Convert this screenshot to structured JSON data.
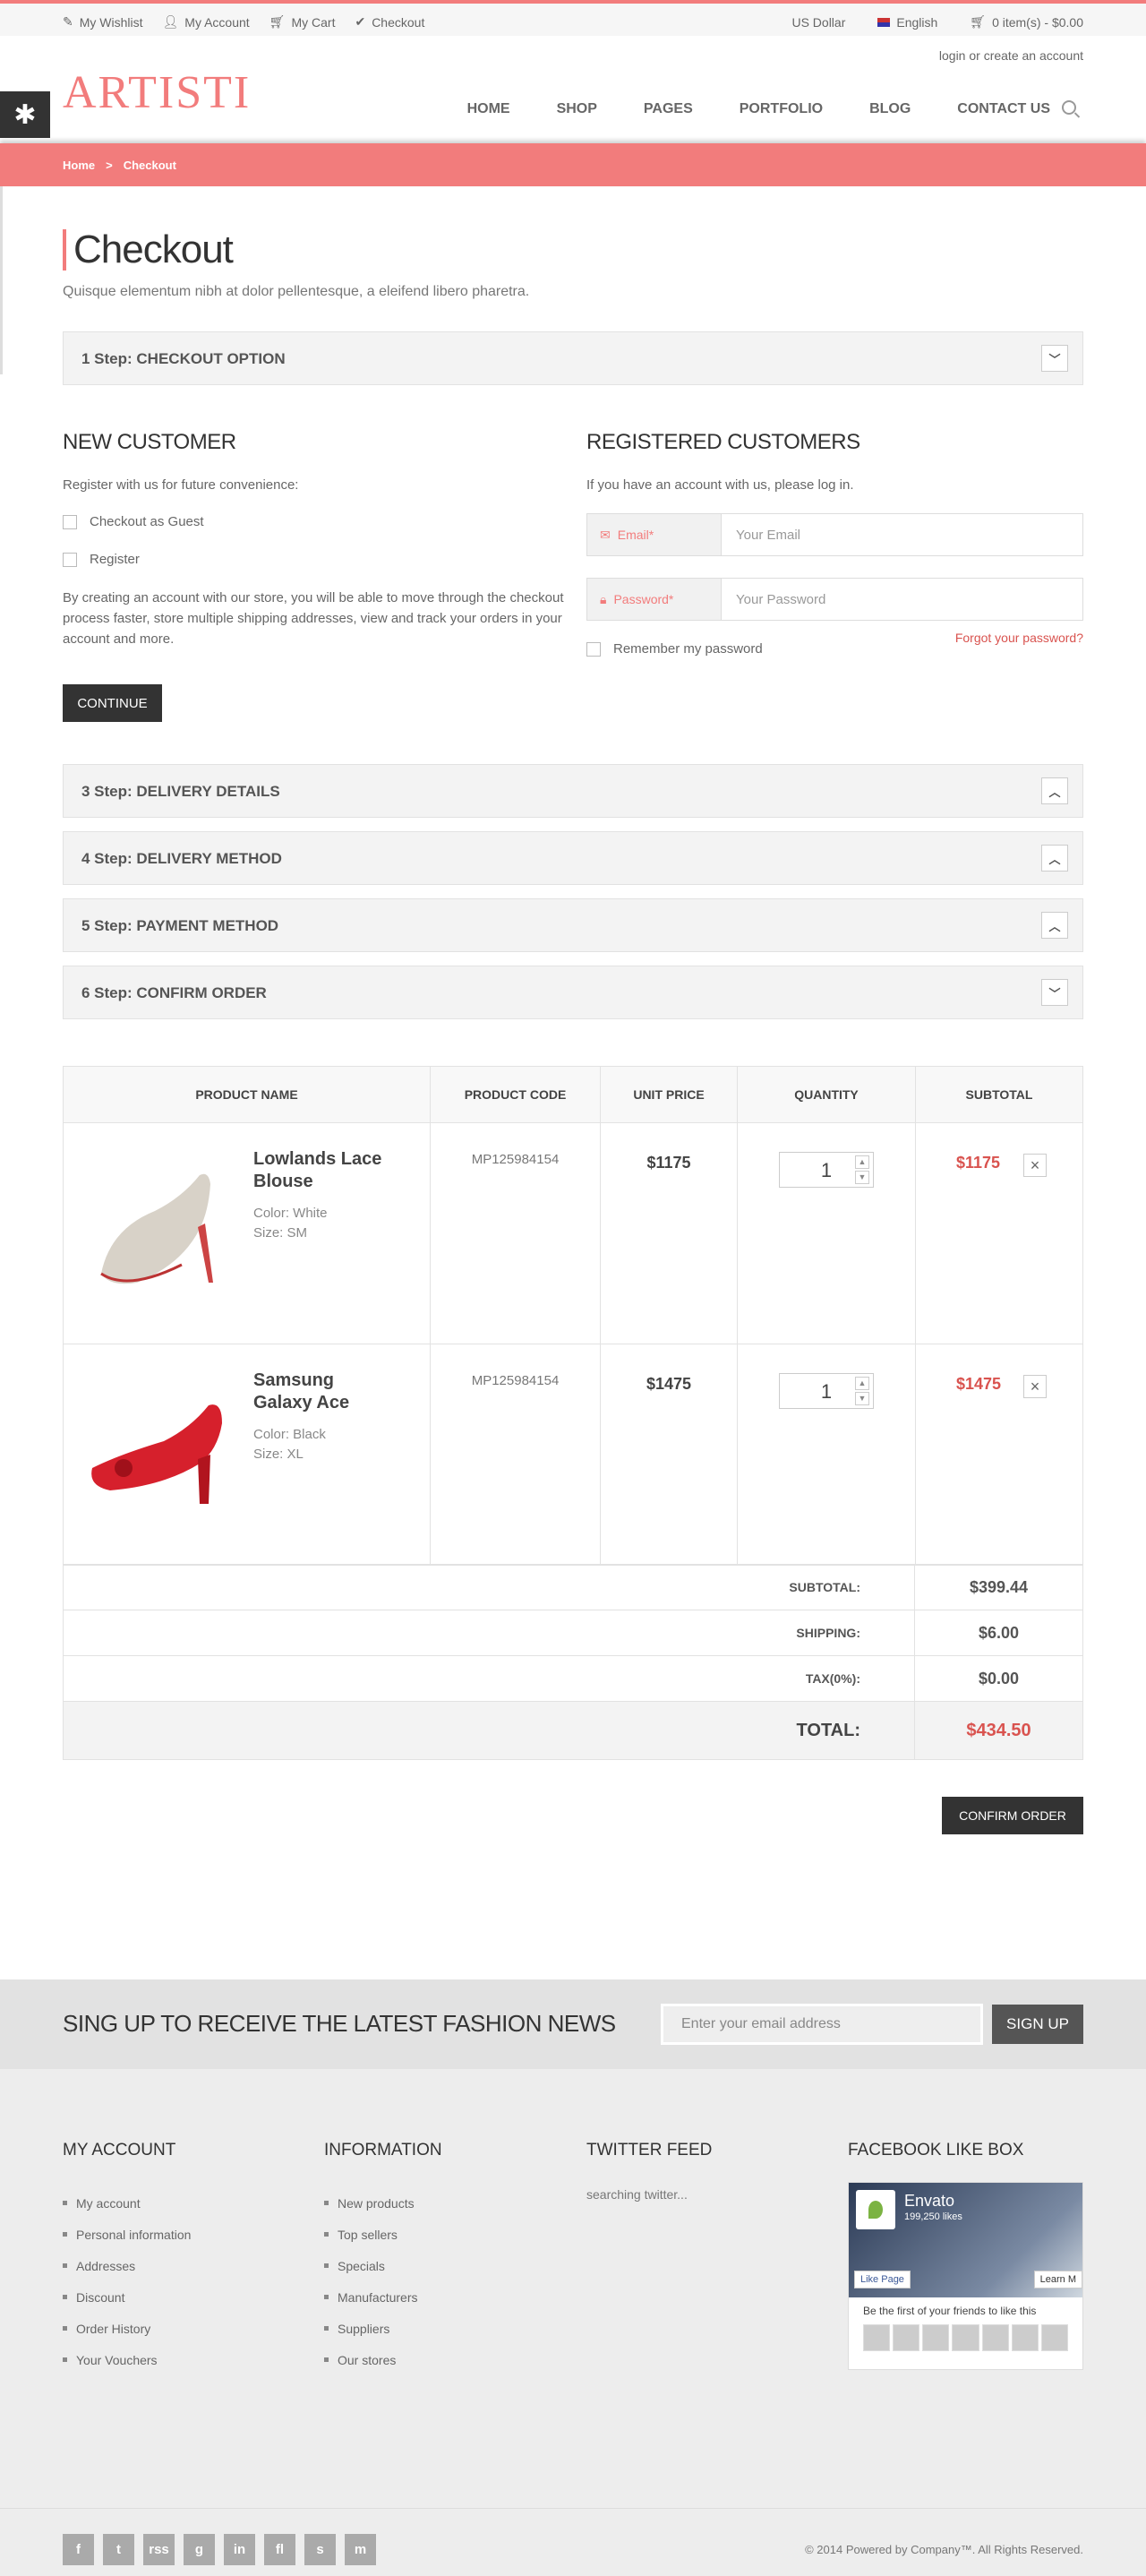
{
  "topbar": {
    "wishlist": "My Wishlist",
    "account": "My Account",
    "cart": "My Cart",
    "checkout": "Checkout",
    "currency": "US Dollar",
    "language": "English",
    "cart_summary": "0 item(s) - $0.00"
  },
  "login": "login or create an account",
  "logo": "ARTISTI",
  "nav": [
    "HOME",
    "SHOP",
    "PAGES",
    "PORTFOLIO",
    "BLOG",
    "CONTACT US"
  ],
  "breadcrumb": {
    "home": "Home",
    "sep": ">",
    "current": "Checkout"
  },
  "page": {
    "title": "Checkout",
    "subtitle": "Quisque elementum nibh at dolor pellentesque, a eleifend libero pharetra."
  },
  "steps": {
    "s1": "1 Step:  CHECKOUT OPTION",
    "s3": "3 Step:  DELIVERY DETAILS",
    "s4": "4 Step:  DELIVERY METHOD",
    "s5": "5 Step:  PAYMENT METHOD",
    "s6": "6 Step:  CONFIRM ORDER"
  },
  "new_customer": {
    "title": "NEW CUSTOMER",
    "intro": "Register with us for future convenience:",
    "guest": "Checkout as Guest",
    "register": "Register",
    "desc": "By creating an account with our store, you will be able to move through the checkout process faster, store multiple shipping addresses, view and track your orders in your account and more.",
    "continue": "CONTINUE"
  },
  "registered": {
    "title": "REGISTERED CUSTOMERS",
    "intro": "If you have an account with us, please log in.",
    "email_label": "Email*",
    "email_ph": "Your Email",
    "password_label": "Password*",
    "password_ph": "Your Password",
    "forgot": "Forgot your password?",
    "remember": "Remember my password"
  },
  "cart": {
    "headers": [
      "PRODUCT NAME",
      "PRODUCT CODE",
      "UNIT PRICE",
      "QUANTITY",
      "SUBTOTAL"
    ],
    "items": [
      {
        "name": "Lowlands Lace Blouse",
        "color": "Color: White",
        "size": "Size: SM",
        "code": "MP125984154",
        "price": "$1175",
        "qty": "1",
        "subtotal": "$1175"
      },
      {
        "name": "Samsung Galaxy Ace",
        "color": "Color: Black",
        "size": "Size: XL",
        "code": "MP125984154",
        "price": "$1475",
        "qty": "1",
        "subtotal": "$1475"
      }
    ]
  },
  "totals": {
    "subtotal_label": "SUBTOTAL:",
    "subtotal": "$399.44",
    "shipping_label": "SHIPPING:",
    "shipping": "$6.00",
    "tax_label": "TAX(0%):",
    "tax": "$0.00",
    "total_label": "TOTAL:",
    "total": "$434.50"
  },
  "confirm": "CONFIRM ORDER",
  "newsletter": {
    "title": "SING UP TO RECEIVE THE LATEST FASHION NEWS",
    "placeholder": "Enter your email address",
    "button": "SIGN UP"
  },
  "footer": {
    "account_title": "MY ACCOUNT",
    "account": [
      "My account",
      "Personal information",
      "Addresses",
      "Discount",
      "Order History",
      "Your Vouchers"
    ],
    "info_title": "INFORMATION",
    "info": [
      "New products",
      "Top sellers",
      "Specials",
      "Manufacturers",
      "Suppliers",
      "Our stores"
    ],
    "twitter_title": "TWITTER FEED",
    "twitter": "searching twitter...",
    "fb_title": "FACEBOOK LIKE BOX",
    "fb_name": "Envato",
    "fb_likes": "199,250 likes",
    "fb_like": "Like Page",
    "fb_learn": "Learn M",
    "fb_friends": "Be the first of your friends to like this"
  },
  "social": [
    "f",
    "t",
    "rss",
    "g",
    "in",
    "fl",
    "s",
    "m"
  ],
  "copyright": "© 2014 Powered by Company™. All Rights Reserved.",
  "colors": {
    "accent": "#f27c7c",
    "dark": "#333333",
    "price_red": "#d9534f"
  }
}
